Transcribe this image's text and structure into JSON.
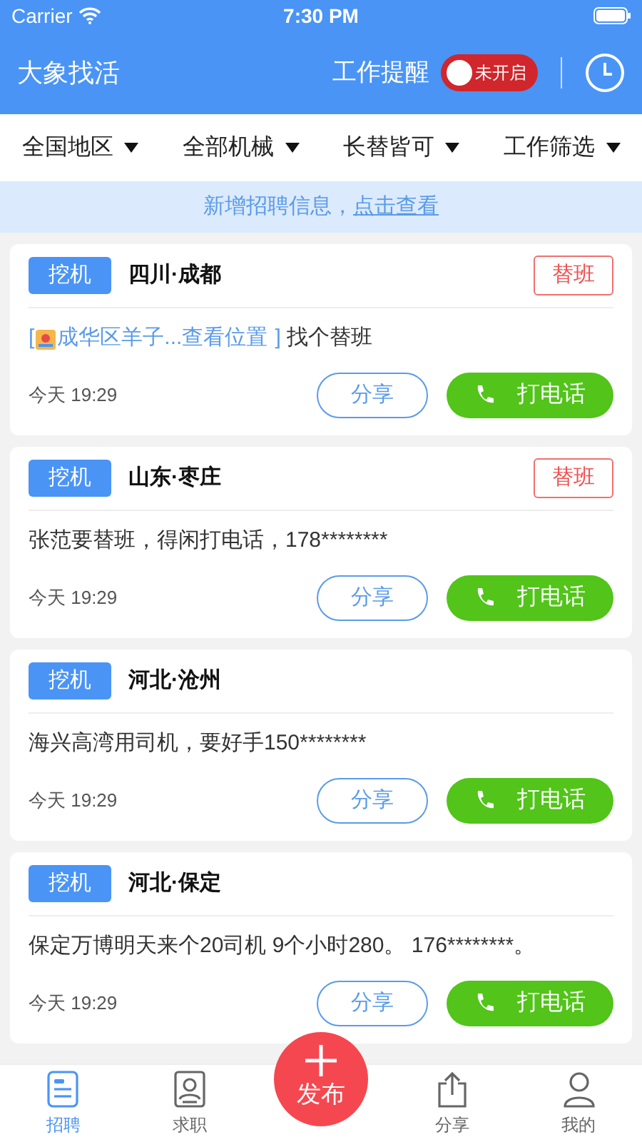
{
  "status_bar": {
    "carrier": "Carrier",
    "time": "7:30 PM"
  },
  "header": {
    "title": "大象找活",
    "reminder": {
      "label": "工作提醒",
      "on": false,
      "state_text": "未开启"
    }
  },
  "filters": [
    {
      "label": "全国地区"
    },
    {
      "label": "全部机械"
    },
    {
      "label": "长替皆可"
    },
    {
      "label": "工作筛选"
    }
  ],
  "notice": {
    "text": "新增招聘信息，",
    "link": "点击查看"
  },
  "cards": [
    {
      "category": "挖机",
      "place": "四川·成都",
      "tag": "替班",
      "location": {
        "open": "[",
        "label": "成华区羊子...查看位置",
        "close": "]"
      },
      "text": "找个替班",
      "time": "今天 19:29",
      "share": "分享",
      "call": "打电话"
    },
    {
      "category": "挖机",
      "place": "山东·枣庄",
      "tag": "替班",
      "text": "张范要替班，得闲打电话，178********",
      "time": "今天 19:29",
      "share": "分享",
      "call": "打电话"
    },
    {
      "category": "挖机",
      "place": "河北·沧州",
      "text": "海兴高湾用司机，要好手150********",
      "time": "今天 19:29",
      "share": "分享",
      "call": "打电话"
    },
    {
      "category": "挖机",
      "place": "河北·保定",
      "text": "保定万博明天来个20司机 9个小时280。 176********。",
      "time": "今天 19:29",
      "share": "分享",
      "call": "打电话"
    }
  ],
  "tab_bar": [
    {
      "kind": "list",
      "label": "招聘",
      "selected": true
    },
    {
      "kind": "person-card",
      "label": "求职",
      "selected": false
    },
    {
      "kind": "publish",
      "label": "发布",
      "selected": false
    },
    {
      "kind": "share",
      "label": "分享",
      "selected": false
    },
    {
      "kind": "user",
      "label": "我的",
      "selected": false
    }
  ]
}
